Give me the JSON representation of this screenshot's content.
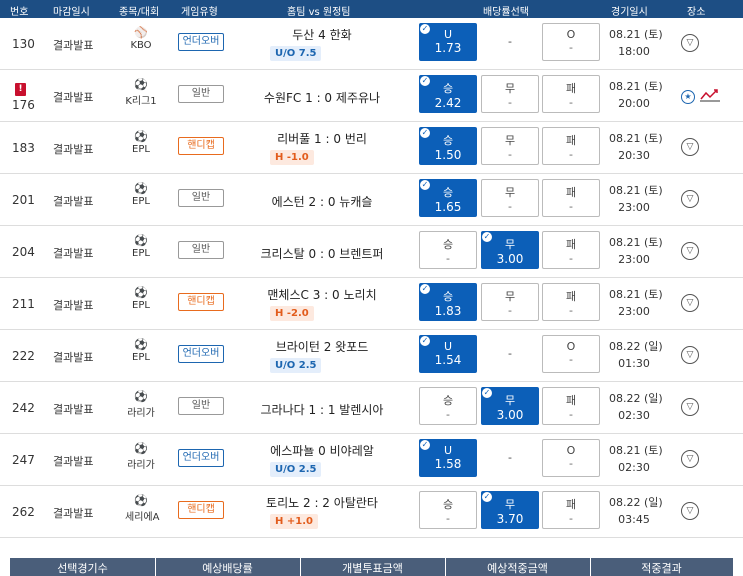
{
  "header": {
    "col_no": "번호",
    "col_deadline": "마감일시",
    "col_sport": "종목/대회",
    "col_type": "게임유형",
    "col_match": "홈팀 vs 원정팀",
    "col_odds": "배당률선택",
    "col_date": "경기일시",
    "col_place": "장소"
  },
  "rows": [
    {
      "no": "130",
      "deadline": "결과발표",
      "sport_icon": "baseball-icon",
      "sport_glyph": "⚾",
      "league": "KBO",
      "type": "언더오버",
      "type_kind": "uo",
      "home": "두산",
      "away": "한화",
      "score": "4",
      "badge": "U/O 7.5",
      "badge_kind": "uo",
      "o1l": "U",
      "o1v": "1.73",
      "o2l": "-",
      "o2v": "",
      "o3l": "O",
      "o3v": "-",
      "sel": 1,
      "date1": "08.21 (토)",
      "date2": "18:00"
    },
    {
      "no": "176",
      "deadline": "결과발표",
      "sport_icon": "soccer-ball-icon",
      "sport_glyph": "⚽",
      "league": "K리그1",
      "type": "일반",
      "type_kind": "gen",
      "home": "수원FC",
      "away": "제주유나",
      "score": "1 : 0",
      "badge": "",
      "badge_kind": "",
      "o1l": "승",
      "o1v": "2.42",
      "o2l": "무",
      "o2v": "-",
      "o3l": "패",
      "o3v": "-",
      "sel": 1,
      "date1": "08.21 (토)",
      "date2": "20:00",
      "alert": "!"
    },
    {
      "no": "183",
      "deadline": "결과발표",
      "sport_icon": "soccer-ball-icon",
      "sport_glyph": "⚽",
      "league": "EPL",
      "type": "핸디캡",
      "type_kind": "hc",
      "home": "리버풀",
      "away": "번리",
      "score": "1 : 0",
      "badge": "H -1.0",
      "badge_kind": "hc",
      "o1l": "승",
      "o1v": "1.50",
      "o2l": "무",
      "o2v": "-",
      "o3l": "패",
      "o3v": "-",
      "sel": 1,
      "date1": "08.21 (토)",
      "date2": "20:30"
    },
    {
      "no": "201",
      "deadline": "결과발표",
      "sport_icon": "soccer-ball-icon",
      "sport_glyph": "⚽",
      "league": "EPL",
      "type": "일반",
      "type_kind": "gen",
      "home": "에스턴",
      "away": "뉴캐슬",
      "score": "2 : 0",
      "badge": "",
      "badge_kind": "",
      "o1l": "승",
      "o1v": "1.65",
      "o2l": "무",
      "o2v": "-",
      "o3l": "패",
      "o3v": "-",
      "sel": 1,
      "date1": "08.21 (토)",
      "date2": "23:00"
    },
    {
      "no": "204",
      "deadline": "결과발표",
      "sport_icon": "soccer-ball-icon",
      "sport_glyph": "⚽",
      "league": "EPL",
      "type": "일반",
      "type_kind": "gen",
      "home": "크리스탈",
      "away": "브렌트퍼",
      "score": "0 : 0",
      "badge": "",
      "badge_kind": "",
      "o1l": "승",
      "o1v": "-",
      "o2l": "무",
      "o2v": "3.00",
      "o3l": "패",
      "o3v": "-",
      "sel": 2,
      "date1": "08.21 (토)",
      "date2": "23:00"
    },
    {
      "no": "211",
      "deadline": "결과발표",
      "sport_icon": "soccer-ball-icon",
      "sport_glyph": "⚽",
      "league": "EPL",
      "type": "핸디캡",
      "type_kind": "hc",
      "home": "맨체스C",
      "away": "노리치",
      "score": "3 : 0",
      "badge": "H -2.0",
      "badge_kind": "hc",
      "o1l": "승",
      "o1v": "1.83",
      "o2l": "무",
      "o2v": "-",
      "o3l": "패",
      "o3v": "-",
      "sel": 1,
      "date1": "08.21 (토)",
      "date2": "23:00"
    },
    {
      "no": "222",
      "deadline": "결과발표",
      "sport_icon": "soccer-ball-icon",
      "sport_glyph": "⚽",
      "league": "EPL",
      "type": "언더오버",
      "type_kind": "uo",
      "home": "브라이턴",
      "away": "왓포드",
      "score": "2",
      "badge": "U/O 2.5",
      "badge_kind": "uo",
      "o1l": "U",
      "o1v": "1.54",
      "o2l": "-",
      "o2v": "",
      "o3l": "O",
      "o3v": "-",
      "sel": 1,
      "date1": "08.22 (일)",
      "date2": "01:30"
    },
    {
      "no": "242",
      "deadline": "결과발표",
      "sport_icon": "soccer-ball-icon",
      "sport_glyph": "⚽",
      "league": "라리가",
      "type": "일반",
      "type_kind": "gen",
      "home": "그라나다",
      "away": "발렌시아",
      "score": "1 : 1",
      "badge": "",
      "badge_kind": "",
      "o1l": "승",
      "o1v": "-",
      "o2l": "무",
      "o2v": "3.00",
      "o3l": "패",
      "o3v": "-",
      "sel": 2,
      "date1": "08.22 (일)",
      "date2": "02:30"
    },
    {
      "no": "247",
      "deadline": "결과발표",
      "sport_icon": "soccer-ball-icon",
      "sport_glyph": "⚽",
      "league": "라리가",
      "type": "언더오버",
      "type_kind": "uo",
      "home": "에스파뇰",
      "away": "비야레알",
      "score": "0",
      "badge": "U/O 2.5",
      "badge_kind": "uo",
      "o1l": "U",
      "o1v": "1.58",
      "o2l": "-",
      "o2v": "",
      "o3l": "O",
      "o3v": "-",
      "sel": 1,
      "date1": "08.21 (토)",
      "date2": "02:30"
    },
    {
      "no": "262",
      "deadline": "결과발표",
      "sport_icon": "soccer-ball-icon",
      "sport_glyph": "⚽",
      "league": "세리에A",
      "type": "핸디캡",
      "type_kind": "hc",
      "home": "토리노",
      "away": "아탈란타",
      "score": "2 : 2",
      "badge": "H +1.0",
      "badge_kind": "hc",
      "o1l": "승",
      "o1v": "-",
      "o2l": "무",
      "o2v": "3.70",
      "o3l": "패",
      "o3v": "-",
      "sel": 2,
      "date1": "08.22 (일)",
      "date2": "03:45"
    }
  ],
  "footer": {
    "col1": "선택경기수",
    "col2": "예상배당률",
    "col3": "개별투표금액",
    "col4": "예상적중금액",
    "col5": "적중결과"
  },
  "colors": {
    "header_bg": "#1d4e84",
    "selected_bg": "#0c5fb8",
    "handicap": "#e86b1e",
    "underover": "#1d66b0",
    "footer_bg": "#4a5e7a"
  }
}
